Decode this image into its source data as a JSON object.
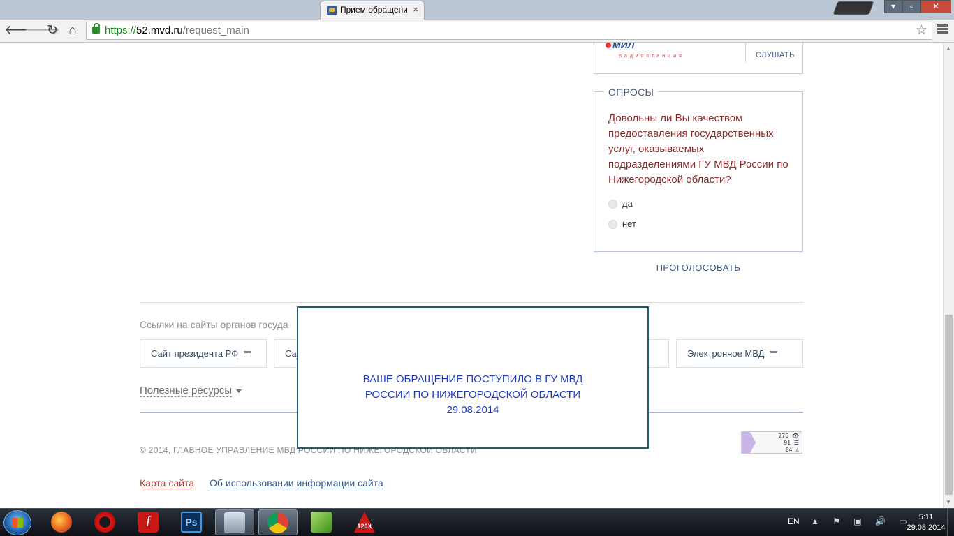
{
  "browser": {
    "tab_title": "Прием обращени",
    "tab_close": "×",
    "url_scheme": "https://",
    "url_host": "52.mvd.ru",
    "url_path": "/request_main",
    "back": "🡐",
    "forward": "🡒",
    "reload": "↻",
    "home": "⌂",
    "bookmark_star": "☆"
  },
  "window_controls": {
    "minimize": "▾",
    "maximize": "▫",
    "close": "✕"
  },
  "radio": {
    "logo": "МИЛ",
    "subtitle": "радиостанция",
    "listen": "СЛУШАТЬ"
  },
  "polls": {
    "title": "ОПРОСЫ",
    "question": "Довольны ли Вы качеством предоставления государственных услуг, оказываемых подразделениями ГУ МВД России по Нижегородской области?",
    "options": [
      {
        "label": "да"
      },
      {
        "label": "нет"
      }
    ],
    "vote_button": "ПРОГОЛОСОВАТЬ"
  },
  "links_section": {
    "title": "Ссылки на сайты органов госуда",
    "links": [
      {
        "label": "Сайт президента РФ"
      },
      {
        "label": "Са"
      },
      {
        "label": "Электронное МВД"
      }
    ]
  },
  "useful_resources": "Полезные ресурсы",
  "copyright": "© 2014, ГЛАВНОЕ УПРАВЛЕНИЕ МВД РОССИИ ПО НИЖЕГОРОДСКОЙ ОБЛАСТИ",
  "counter": {
    "views": "276",
    "visitors": "91",
    "hosts": "84"
  },
  "footer_links": {
    "sitemap": "Карта сайта",
    "usage_info": "Об использовании информации сайта"
  },
  "modal": {
    "line1": "ВАШЕ ОБРАЩЕНИЕ ПОСТУПИЛО В ГУ МВД",
    "line2": "РОССИИ ПО НИЖЕГОРОДСКОЙ ОБЛАСТИ",
    "line3": "29.08.2014"
  },
  "taskbar": {
    "apps": [
      {
        "name": "firefox"
      },
      {
        "name": "opera"
      },
      {
        "name": "flash"
      },
      {
        "name": "photoshop",
        "label": "Ps"
      },
      {
        "name": "calculator"
      },
      {
        "name": "chrome"
      },
      {
        "name": "notepad"
      },
      {
        "name": "autocad",
        "label": "120X"
      }
    ],
    "flash_label": "f",
    "language": "EN",
    "tray_icons": "▲ ⚑ ▣ 🔊 ▭",
    "time": "5:11",
    "date": "29.08.2014"
  }
}
